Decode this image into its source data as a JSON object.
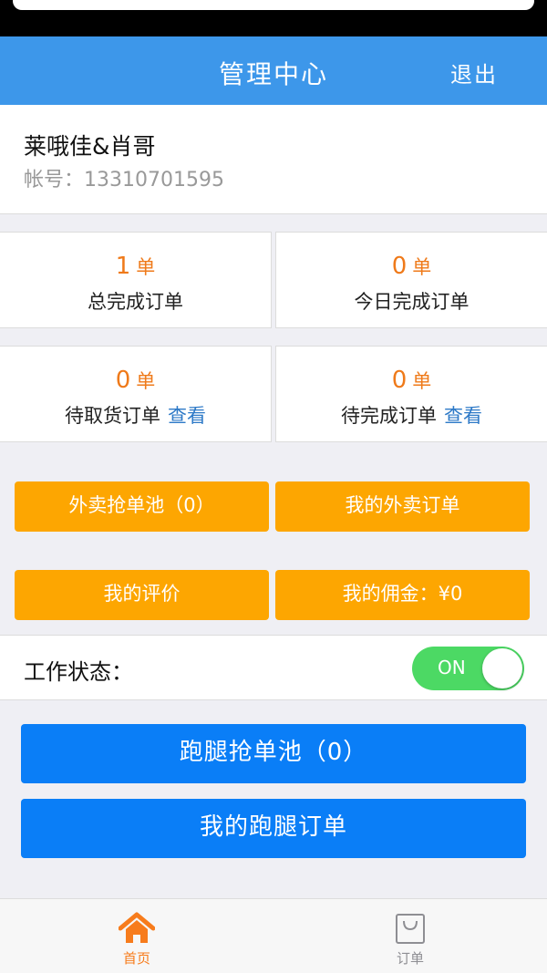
{
  "header": {
    "title": "管理中心",
    "logout": "退出"
  },
  "profile": {
    "name": "莱哦佳&肖哥",
    "account": "帐号：13310701595"
  },
  "unit": "单",
  "view_label": "查看",
  "stats_row1": [
    {
      "value": "1",
      "label": "总完成订单"
    },
    {
      "value": "0",
      "label": "今日完成订单"
    }
  ],
  "stats_row2": [
    {
      "value": "0",
      "label": "待取货订单"
    },
    {
      "value": "0",
      "label": "待完成订单"
    }
  ],
  "orange_buttons": {
    "takeout_pool": "外卖抢单池（0）",
    "my_takeout": "我的外卖订单",
    "my_reviews": "我的评价",
    "my_commission": "我的佣金：¥0"
  },
  "work_status": {
    "label": "工作状态：",
    "toggle": "ON",
    "on": true
  },
  "blue_buttons": {
    "errand_pool": "跑腿抢单池（0）",
    "my_errand": "我的跑腿订单"
  },
  "tabbar": {
    "home": "首页",
    "orders": "订单",
    "home_icon": "home-icon",
    "orders_icon": "shopping-bag-icon"
  },
  "colors": {
    "header": "#3d97ea",
    "accent_orange": "#fda601",
    "stat_orange": "#ef7a1a",
    "primary_blue": "#0a7ef7",
    "toggle_on": "#4cd964",
    "link_blue": "#2d79c7"
  }
}
